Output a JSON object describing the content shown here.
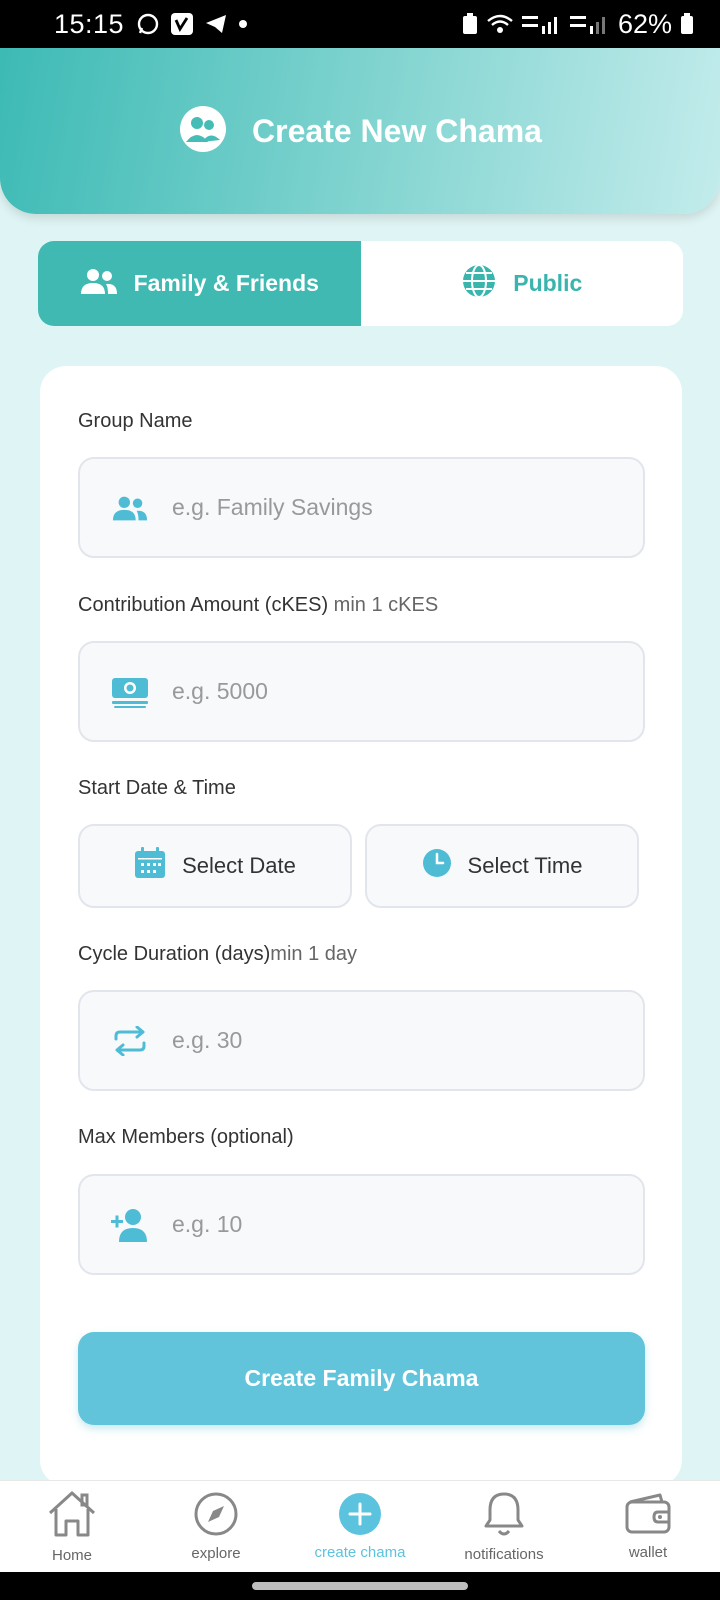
{
  "status_bar": {
    "time": "15:15",
    "battery": "62%"
  },
  "header": {
    "title": "Create New Chama"
  },
  "tabs": [
    {
      "label": "Family & Friends",
      "active": true
    },
    {
      "label": "Public",
      "active": false
    }
  ],
  "form": {
    "group_name": {
      "label": "Group Name",
      "placeholder": "e.g. Family Savings"
    },
    "contribution": {
      "label": "Contribution Amount (cKES)",
      "hint": " min 1 cKES",
      "placeholder": "e.g. 5000"
    },
    "start": {
      "label": "Start Date & Time",
      "date_label": "Select Date",
      "time_label": "Select Time"
    },
    "cycle": {
      "label": "Cycle Duration (days)",
      "hint": "min 1 day",
      "placeholder": "e.g. 30"
    },
    "max_members": {
      "label": "Max Members (optional)",
      "placeholder": "e.g. 10"
    },
    "submit_label": "Create Family Chama"
  },
  "nav": {
    "items": [
      {
        "label": "Home",
        "icon": "home-icon"
      },
      {
        "label": "explore",
        "icon": "compass-icon"
      },
      {
        "label": "create chama",
        "icon": "plus-icon"
      },
      {
        "label": "notifications",
        "icon": "bell-icon"
      },
      {
        "label": "wallet",
        "icon": "wallet-icon"
      }
    ]
  },
  "colors": {
    "primary": "#40b9b3",
    "button": "#62c4da",
    "icon": "#4fbcd6",
    "background": "#dff4f4"
  }
}
